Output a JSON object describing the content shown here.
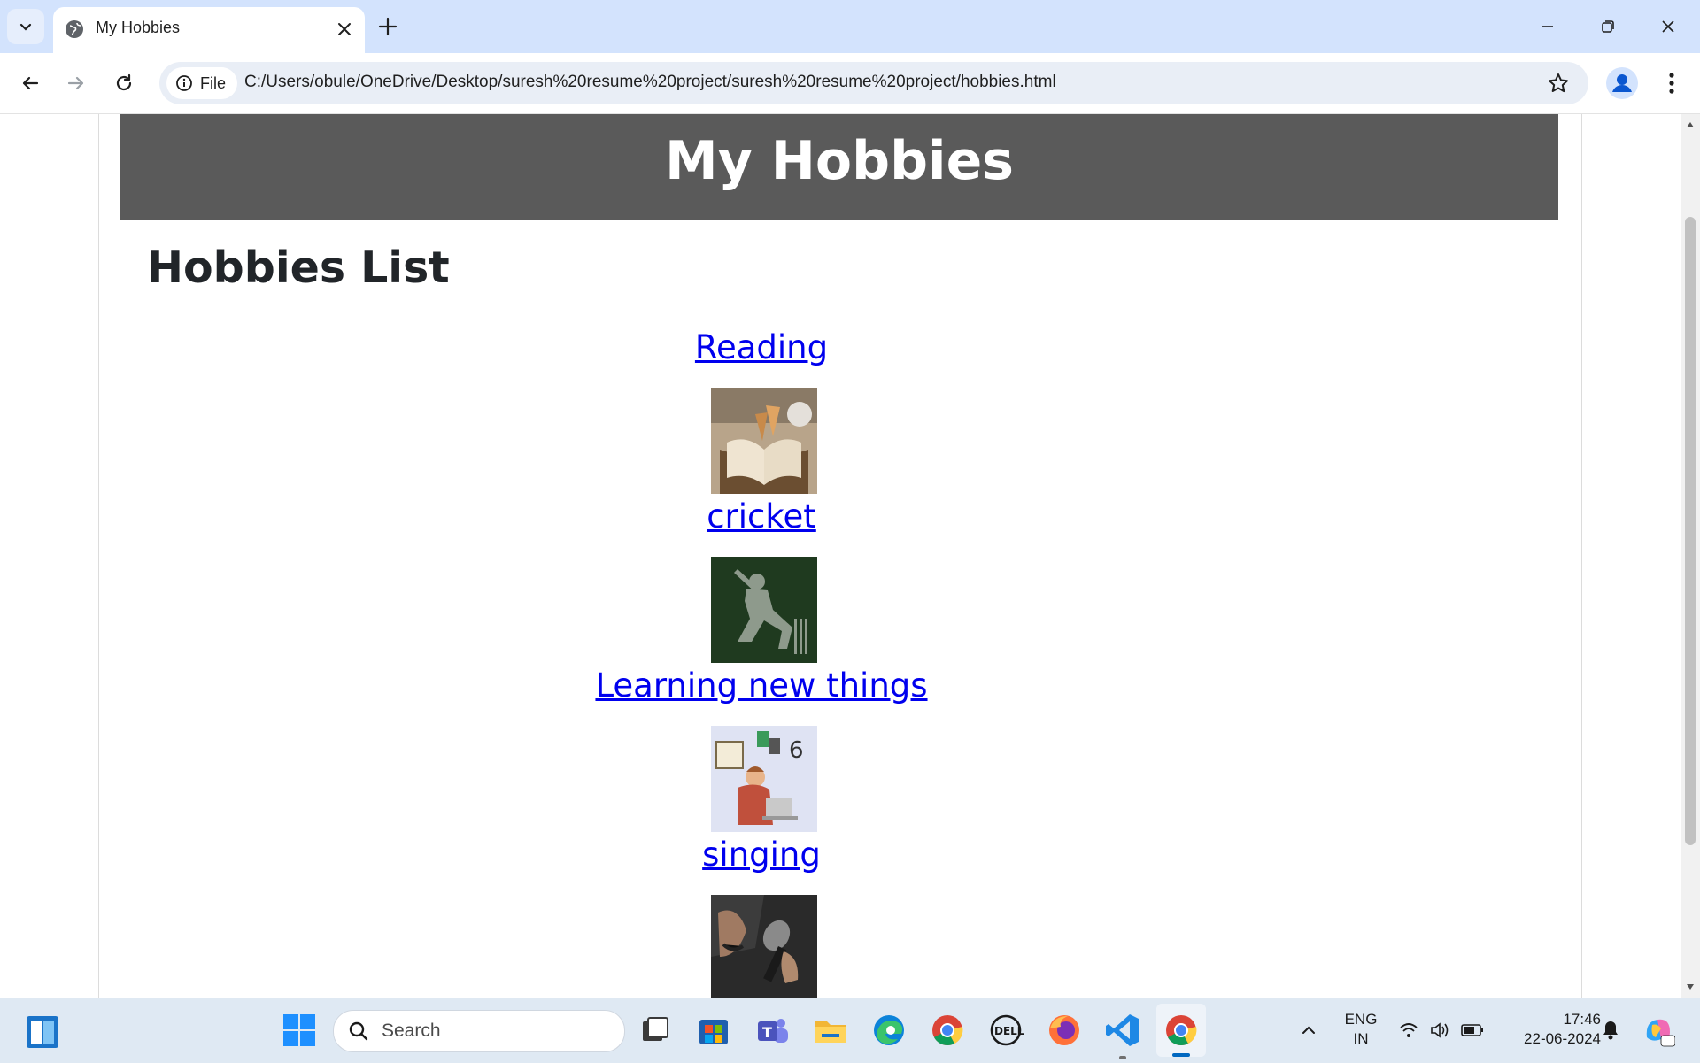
{
  "browser": {
    "tab_title": "My Hobbies",
    "site_chip_label": "File",
    "url": "C:/Users/obule/OneDrive/Desktop/suresh%20resume%20project/suresh%20resume%20project/hobbies.html"
  },
  "page": {
    "header_title": "My Hobbies",
    "section_title": "Hobbies List",
    "hobbies": [
      {
        "label": "Reading",
        "image": "reading-book-image"
      },
      {
        "label": "cricket",
        "image": "cricket-batsman-image"
      },
      {
        "label": "Learning new things",
        "image": "learning-laptop-image"
      },
      {
        "label": "singing",
        "image": "singing-microphone-image"
      }
    ]
  },
  "taskbar": {
    "search_label": "Search",
    "lang_top": "ENG",
    "lang_bottom": "IN",
    "time": "17:46",
    "date": "22-06-2024"
  },
  "colors": {
    "header_band": "#5a5a5a",
    "link": "#0000ee",
    "tabstrip": "#d3e3fd",
    "taskbar": "#dfe9f3"
  }
}
